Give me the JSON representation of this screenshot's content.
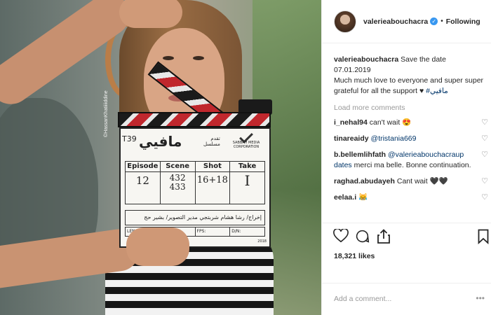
{
  "media": {
    "photo_credit": "©HassanKhatiiiiddine",
    "clapperboard": {
      "title": "مافيي",
      "scene_code": "T39",
      "presents": "تقدم\nمسلسل",
      "production": "SABBAH MEDIA CORPORATION",
      "labels": {
        "episode": "Episode",
        "scene": "Scene",
        "shot": "Shot",
        "take": "Take"
      },
      "values": {
        "episode": "12",
        "scene": "432\n433",
        "shot": "16+18",
        "take": "I"
      },
      "crew": "إخراج/ رشا هشام شربتجي  مدير التصوير/ بشير حج",
      "crew_dop_label": "مدير\nالتصوير",
      "tech": [
        "LENS:",
        "Reel:",
        "FPS:",
        "D/N:",
        ""
      ],
      "year": "2018"
    }
  },
  "header": {
    "username": "valerieabouchacra",
    "verified_glyph": "✓",
    "separator": "•",
    "follow_status": "Following"
  },
  "caption": {
    "username": "valerieabouchacra",
    "line1": "Save the date",
    "line2": "07.01.2019",
    "line3": "Much much love to everyone and super super grateful for all the support ♥",
    "hashtag": "#مافيي"
  },
  "load_more": "Load more comments",
  "comments": [
    {
      "username": "i_nehal94",
      "text": "can't wait 😍"
    },
    {
      "username": "tinareaidy",
      "mention": "@tristania669",
      "text": ""
    },
    {
      "username": "b.bellemlihfath",
      "mention": "@valerieabouchacraup dates",
      "text": "merci ma belle. Bonne continuation."
    },
    {
      "username": "raghad.abudayeh",
      "text": "Cant wait 🖤🖤"
    },
    {
      "username": "eelaa.i",
      "text": "😹"
    }
  ],
  "likes": "18,321 likes",
  "add_comment_placeholder": "Add a comment...",
  "more_glyph": "•••"
}
